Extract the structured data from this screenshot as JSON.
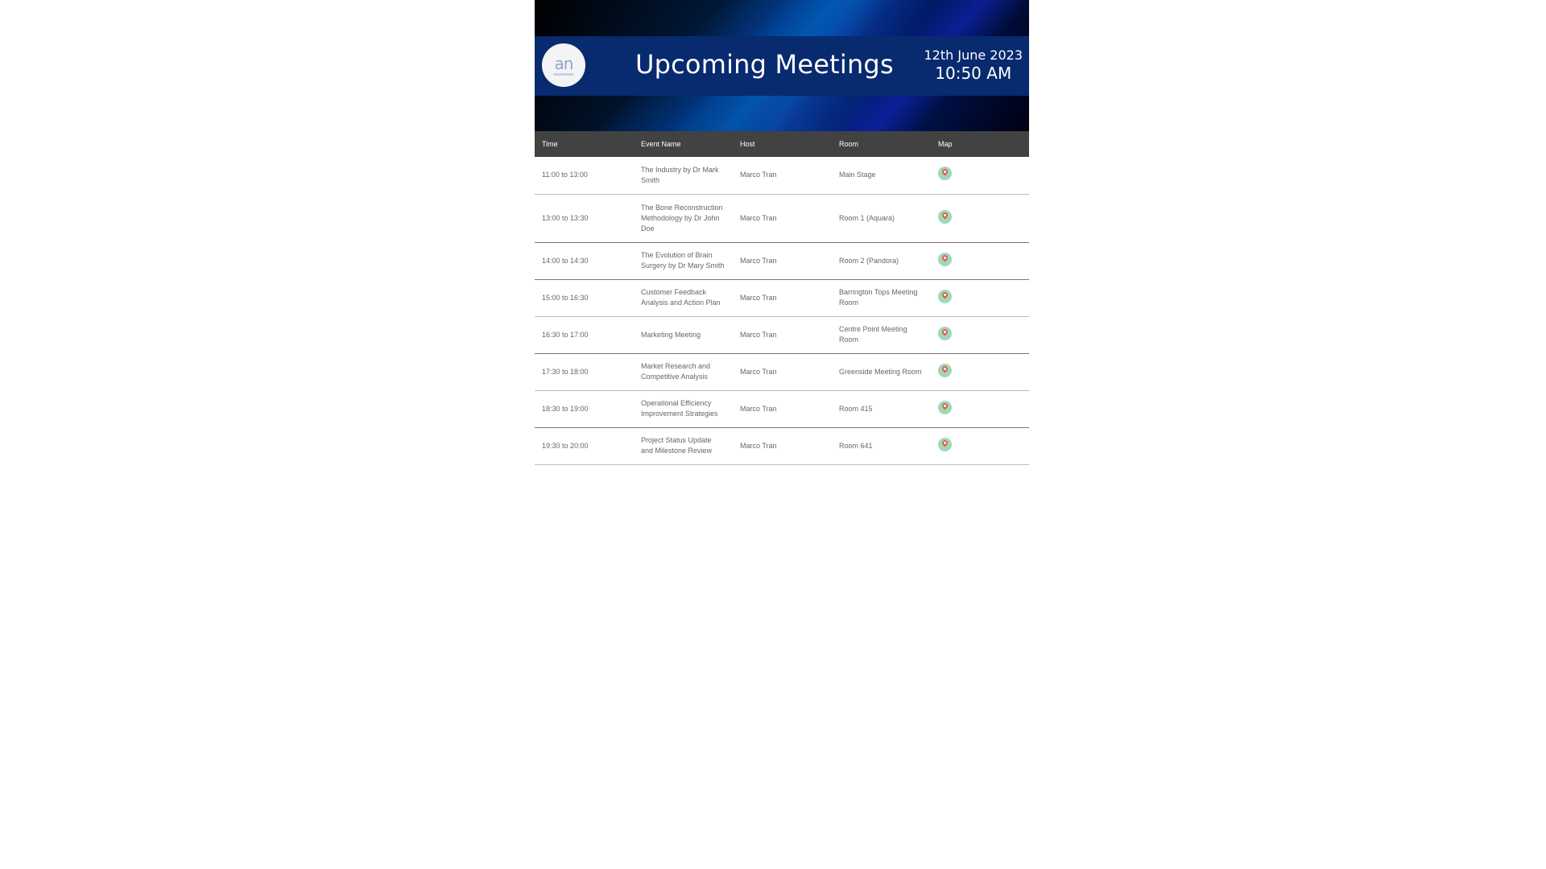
{
  "header": {
    "title": "Upcoming Meetings",
    "date": "12th June 2023",
    "time": "10:50 AM"
  },
  "logo": {
    "icon": "an-logo-icon"
  },
  "table": {
    "columns": [
      "Time",
      "Event Name",
      "Host",
      "Room",
      "Map"
    ],
    "rows": [
      {
        "time": "11:00 to 13:00",
        "event": "The Industry by Dr Mark Smith",
        "host": "Marco Tran",
        "room": "Main Stage"
      },
      {
        "time": "13:00 to 13:30",
        "event": "The Bone Reconstruction Methodology by Dr John Doe",
        "host": "Marco Tran",
        "room": "Room 1 (Aquara)"
      },
      {
        "time": "14:00 to 14:30",
        "event": "The Evolution of Brain Surgery by Dr Mary Smith",
        "host": "Marco Tran",
        "room": "Room 2 (Pandora)"
      },
      {
        "time": "15:00 to 16:30",
        "event": "Customer Feedback Analysis and Action Plan",
        "host": "Marco Tran",
        "room": "Barrington Tops Meeting Room"
      },
      {
        "time": "16:30 to 17:00",
        "event": "Marketing Meeting",
        "host": "Marco Tran",
        "room": "Centre Point Meeting Room"
      },
      {
        "time": "17:30 to 18:00",
        "event": "Market Research and Competitive Analysis",
        "host": "Marco Tran",
        "room": "Greenside Meeting Room"
      },
      {
        "time": "18:30 to 19:00",
        "event": "Operational Efficiency Improvement Strategies",
        "host": "Marco Tran",
        "room": "Room 415"
      },
      {
        "time": "19:30 to 20:00",
        "event": "Project Status Update and Milestone Review",
        "host": "Marco Tran",
        "room": "Room 641"
      }
    ],
    "map_icon": "map-pin-icon"
  },
  "colors": {
    "title_bar": "#082a6e",
    "table_header": "#424242",
    "map_icon_bg": "#9fd9b6",
    "map_pin": "#e85a4f"
  }
}
